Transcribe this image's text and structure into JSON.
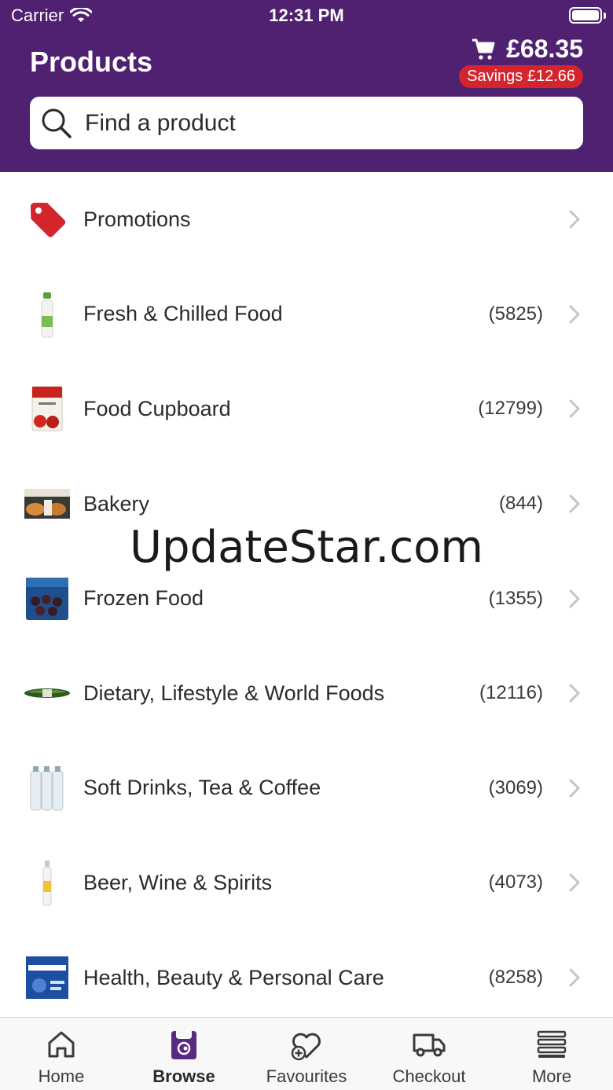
{
  "status_bar": {
    "carrier": "Carrier",
    "time": "12:31 PM"
  },
  "header": {
    "title": "Products",
    "basket_total": "£68.35",
    "savings": "Savings £12.66"
  },
  "search": {
    "placeholder": "Find a product"
  },
  "categories": [
    {
      "label": "Promotions",
      "count": "",
      "icon": "promotion-tag-icon"
    },
    {
      "label": "Fresh & Chilled Food",
      "count": "(5825)",
      "icon": "milk-bottle-thumbnail"
    },
    {
      "label": "Food Cupboard",
      "count": "(12799)",
      "icon": "tinned-tomatoes-thumbnail"
    },
    {
      "label": "Bakery",
      "count": "(844)",
      "icon": "bread-rolls-thumbnail"
    },
    {
      "label": "Frozen Food",
      "count": "(1355)",
      "icon": "frozen-fruit-bag-thumbnail"
    },
    {
      "label": "Dietary, Lifestyle & World Foods",
      "count": "(12116)",
      "icon": "cucumber-thumbnail"
    },
    {
      "label": "Soft Drinks, Tea & Coffee",
      "count": "(3069)",
      "icon": "water-bottles-thumbnail"
    },
    {
      "label": "Beer, Wine & Spirits",
      "count": "(4073)",
      "icon": "tonic-bottle-thumbnail"
    },
    {
      "label": "Health, Beauty & Personal Care",
      "count": "(8258)",
      "icon": "paracetamol-box-thumbnail"
    }
  ],
  "watermark": "UpdateStar.com",
  "tabbar": {
    "tabs": [
      {
        "label": "Home",
        "icon": "home-icon",
        "active": false
      },
      {
        "label": "Browse",
        "icon": "shopping-bag-icon",
        "active": true
      },
      {
        "label": "Favourites",
        "icon": "heart-plus-icon",
        "active": false
      },
      {
        "label": "Checkout",
        "icon": "delivery-van-icon",
        "active": false
      },
      {
        "label": "More",
        "icon": "menu-icon",
        "active": false
      }
    ]
  },
  "colors": {
    "header_bg": "#4f2170",
    "savings_badge": "#d4242e",
    "accent_purple": "#5a2a82"
  }
}
